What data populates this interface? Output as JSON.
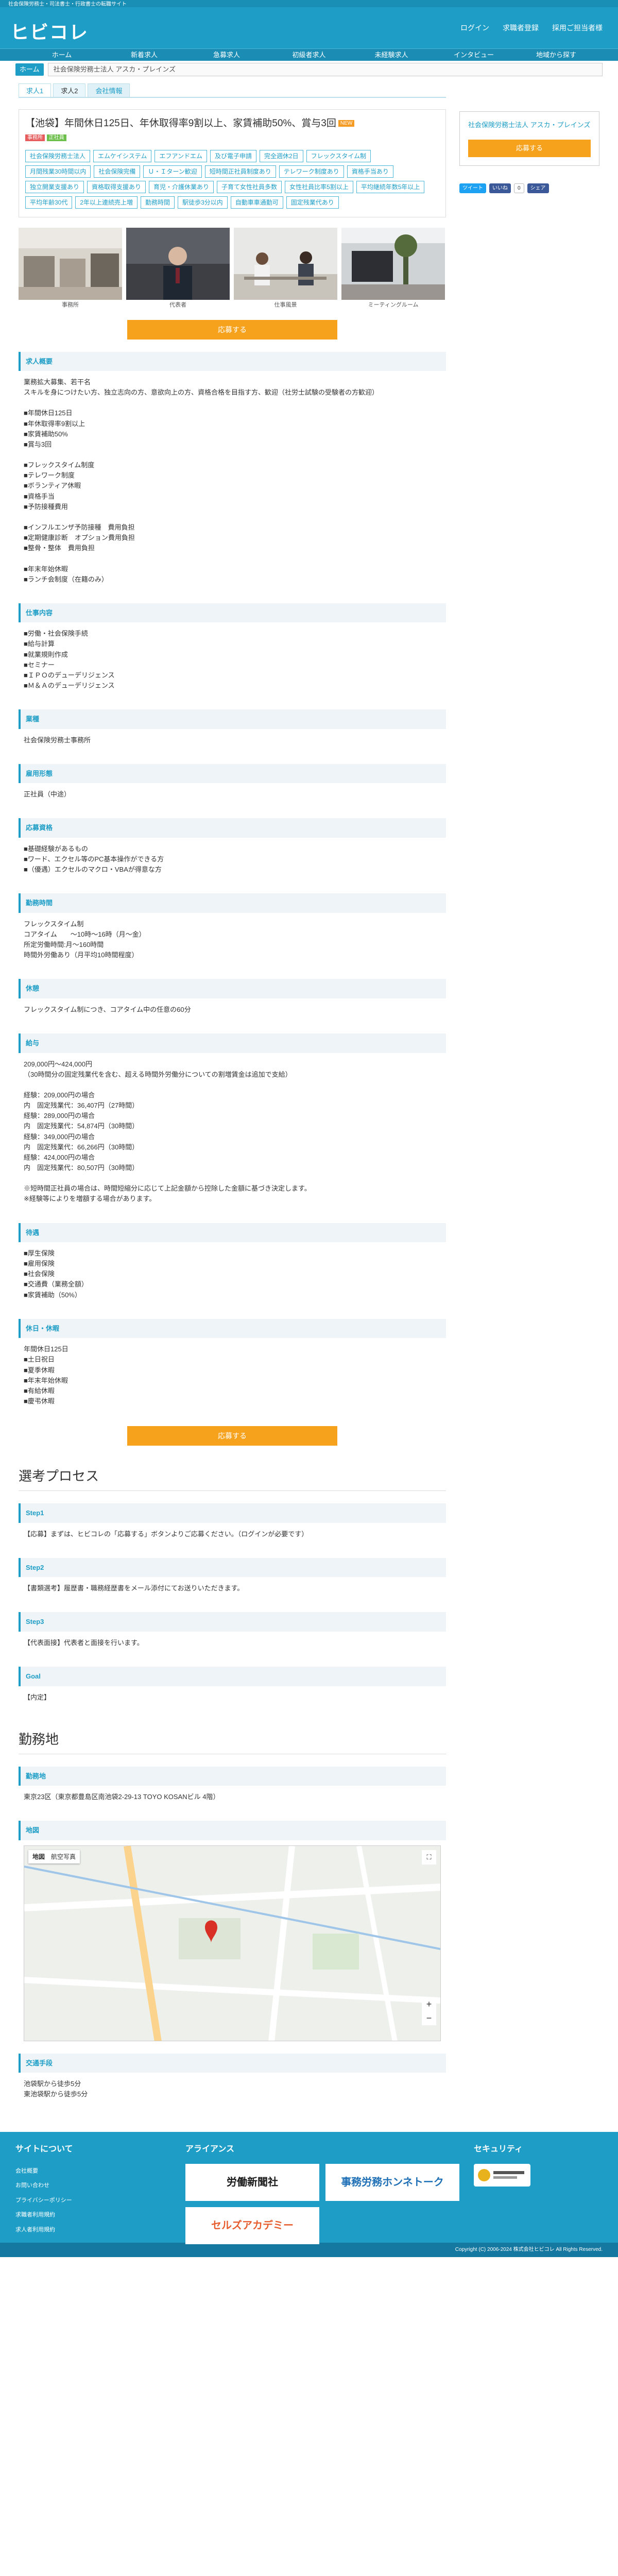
{
  "header": {
    "topbar": "社会保険労務士・司法書士・行政書士の転職サイト",
    "logo": "ヒビコレ",
    "links": [
      "ログイン",
      "求職者登録",
      "採用ご担当者様"
    ]
  },
  "gnav": [
    "ホーム",
    "新着求人",
    "急募求人",
    "初級者求人",
    "未経験求人",
    "インタビュー",
    "地域から探す"
  ],
  "breadcrumb": {
    "home": "ホーム",
    "current": "社会保険労務士法人 アスカ・プレインズ"
  },
  "tabs": [
    "求人1",
    "求人2",
    "会社情報"
  ],
  "job": {
    "title": "【池袋】年間休日125日、年休取得率9割以上、家賃補助50%、賞与3回",
    "new": "NEW",
    "badges": [
      "事務所",
      "正社員"
    ],
    "tags": [
      "社会保険労務士法人",
      "エムケイシステム",
      "エフアンドエム",
      "及び電子申請",
      "完全週休2日",
      "フレックスタイム制",
      "月間残業30時間以内",
      "社会保険完備",
      "Ｕ・Ｉターン歓迎",
      "短時間正社員制度あり",
      "テレワーク制度あり",
      "資格手当あり",
      "独立開業支援あり",
      "資格取得支援あり",
      "育児・介護休業あり",
      "子育て女性社員多数",
      "女性社員比率5割以上",
      "平均継続年数5年以上",
      "平均年齢30代",
      "2年以上連続売上増",
      "勤務時間",
      "駅徒歩3分以内",
      "自動車車通勤可",
      "固定残業代あり"
    ]
  },
  "photos": [
    {
      "cap": "事務所"
    },
    {
      "cap": "代表者"
    },
    {
      "cap": "仕事風景"
    },
    {
      "cap": "ミーティングルーム"
    }
  ],
  "apply": "応募する",
  "sections": [
    {
      "title": "求人概要",
      "body": "業務拡大募集、若干名\nスキルを身につけたい方、独立志向の方、意欲向上の方、資格合格を目指す方、歓迎（社労士試験の受験者の方歓迎）\n\n■年間休日125日\n■年休取得率9割以上\n■家賃補助50%\n■賞与3回\n\n■フレックスタイム制度\n■テレワーク制度\n■ボランティア休暇\n■資格手当\n■予防接種費用\n\n■インフルエンザ予防接種　費用負担\n■定期健康診断　オプション費用負担\n■整骨・整体　費用負担\n\n■年末年始休暇\n■ランチ会制度（在籍のみ）"
    },
    {
      "title": "仕事内容",
      "body": "■労働・社会保険手続\n■給与計算\n■就業規則作成\n■セミナー\n■ＩＰＯのデューデリジェンス\n■Ｍ＆Ａのデューデリジェンス"
    },
    {
      "title": "業種",
      "body": "社会保険労務士事務所"
    },
    {
      "title": "雇用形態",
      "body": "正社員（中途）"
    },
    {
      "title": "応募資格",
      "body": "■基礎経験があるもの\n■ワード、エクセル等のPC基本操作ができる方\n■（優遇）エクセルのマクロ・VBAが得意な方"
    },
    {
      "title": "勤務時間",
      "body": "フレックスタイム制\nコアタイム　　～10時～16時（月～金）\n所定労働時間:月～160時間\n時間外労働あり（月平均10時間程度）"
    },
    {
      "title": "休憩",
      "body": "フレックスタイム制につき、コアタイム中の任意の60分"
    },
    {
      "title": "給与",
      "body": "209,000円～424,000円\n（30時間分の固定残業代を含む、超える時間外労働分についての割増賃金は追加で支給）\n\n経験：209,000円の場合\n内　固定残業代：36,407円（27時間）\n経験：289,000円の場合\n内　固定残業代：54,874円（30時間）\n経験：349,000円の場合\n内　固定残業代：66,266円（30時間）\n経験：424,000円の場合\n内　固定残業代：80,507円（30時間）\n\n※短時間正社員の場合は、時間短縮分に応じて上記金額から控除した金額に基づき決定します。\n※経験等によりを増額する場合があります。"
    },
    {
      "title": "待遇",
      "body": "■厚生保険\n■雇用保険\n■社会保険\n■交通費（業務全額）\n■家賃補助（50%）"
    },
    {
      "title": "休日・休暇",
      "body": "年間休日125日\n■土日祝日\n■夏季休暇\n■年末年始休暇\n■有給休暇\n■慶弔休暇"
    }
  ],
  "selection": {
    "heading": "選考プロセス",
    "steps": [
      {
        "title": "Step1",
        "body": "【応募】まずは、ヒビコレの「応募する」ボタンよりご応募ください。（ログインが必要です）"
      },
      {
        "title": "Step2",
        "body": "【書類選考】履歴書・職務経歴書をメール添付にてお送りいただきます。"
      },
      {
        "title": "Step3",
        "body": "【代表面接】代表者と面接を行います。"
      },
      {
        "title": "Goal",
        "body": "【内定】"
      }
    ]
  },
  "location": {
    "heading": "勤務地",
    "addr_title": "勤務地",
    "addr": "東京23区（東京都豊島区南池袋2-29-13 TOYO KOSANビル 4階）",
    "map_title": "地図",
    "map_tabs": [
      "地図",
      "航空写真"
    ],
    "access_title": "交通手段",
    "access": "池袋駅から徒歩5分\n東池袋駅から徒歩5分"
  },
  "side": {
    "name": "社会保険労務士法人 アスカ・プレインズ",
    "button": "応募する",
    "tw": "ツイート",
    "fb": "いいね",
    "fbshare": "シェア",
    "count": "0"
  },
  "footer": {
    "about": "サイトについて",
    "links": [
      "会社概要",
      "お問い合わせ",
      "プライバシーポリシー",
      "求職者利用規約",
      "求人者利用規約"
    ],
    "alliance": "アライアンス",
    "banners": [
      "労働新聞社",
      "事務労務ホンネトーク",
      "セルズアカデミー"
    ],
    "security": "セキュリティ",
    "copyright": "Copyright (C) 2006-2024 株式会社ヒビコレ All Rights Reserved."
  },
  "colors": {
    "brand": "#1e9ec7",
    "accent": "#f7a21c"
  }
}
